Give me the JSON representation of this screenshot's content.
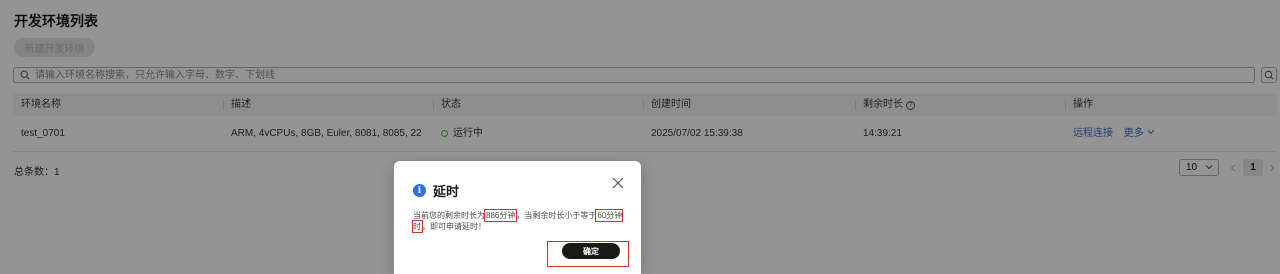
{
  "page": {
    "title": "开发环境列表",
    "create_button": "新建开发环境",
    "search_placeholder": "请输入环境名称搜索，只允许输入字母、数字、下划线"
  },
  "table": {
    "headers": [
      "环境名称",
      "描述",
      "状态",
      "创建时间",
      "剩余时长",
      "操作"
    ],
    "rows": [
      {
        "name": "test_0701",
        "description": "ARM, 4vCPUs, 8GB, Euler, 8081, 8085, 22",
        "status": "运行中",
        "created": "2025/07/02 15:39:38",
        "remaining": "14:39:21",
        "action_remote": "远程连接",
        "action_more": "更多"
      }
    ]
  },
  "footer": {
    "total": "总条数：1",
    "page_size": "10",
    "current_page": "1"
  },
  "dialog": {
    "title": "延时",
    "message_part1": "当前您的剩余时长为",
    "remaining_value": "886分钟",
    "message_part2": "，当剩余时长小于等于",
    "threshold_value": "60分钟时",
    "message_part3": "，即可申请延时！",
    "ok_button": "确定"
  },
  "colors": {
    "accent_blue": "#2f6fe4",
    "status_green": "#4caf50",
    "highlight_red": "#d93025",
    "primary_button": "#191919"
  }
}
